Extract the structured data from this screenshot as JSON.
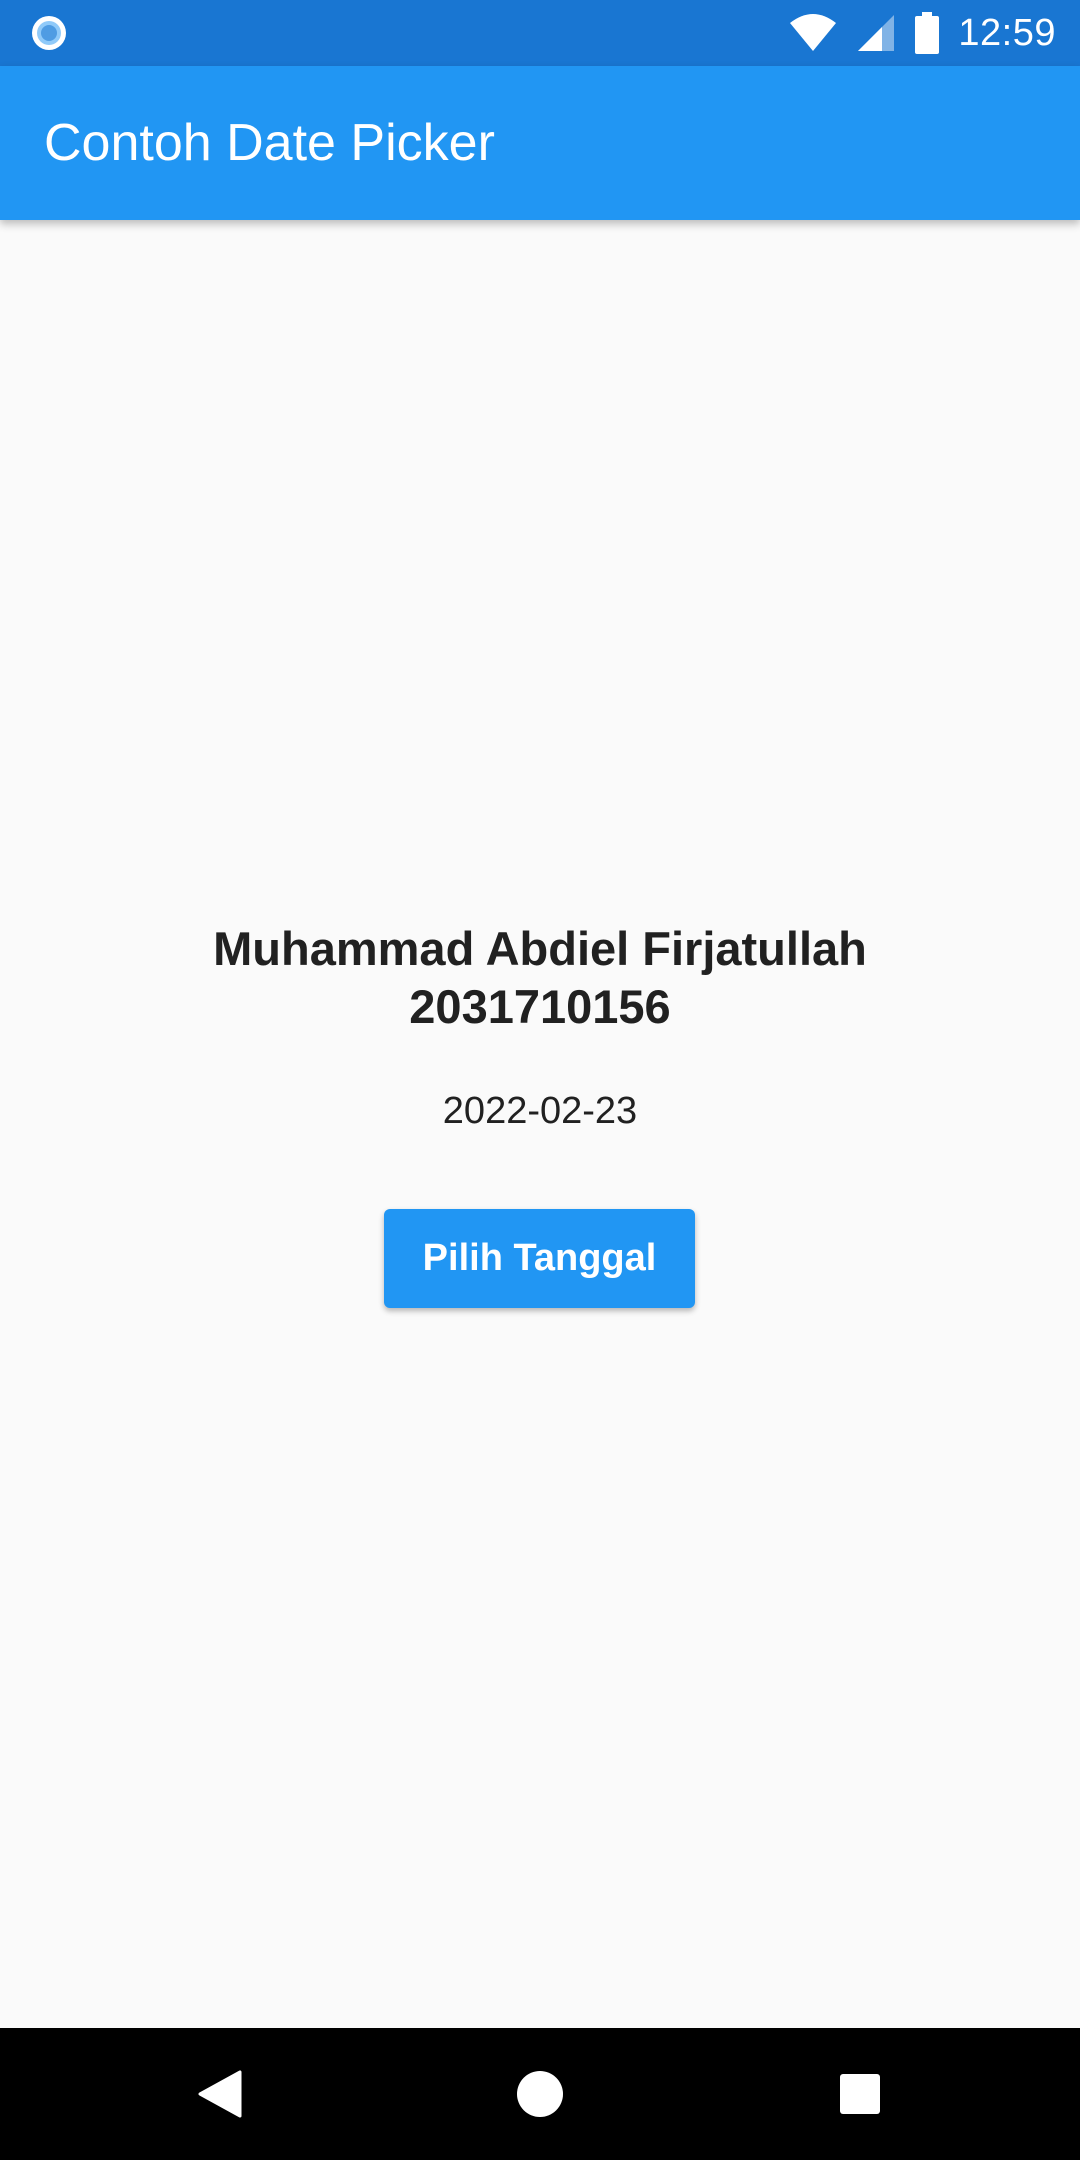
{
  "status_bar": {
    "time": "12:59",
    "color": "#1976d2",
    "icons": [
      "radio-button-icon",
      "wifi-icon",
      "signal-icon",
      "battery-icon"
    ]
  },
  "app_bar": {
    "title": "Contoh Date Picker",
    "color": "#2196f3"
  },
  "main": {
    "name_line1": "Muhammad Abdiel Firjatullah",
    "name_line2": "2031710156",
    "selected_date": "2022-02-23",
    "pick_button_label": "Pilih Tanggal"
  },
  "nav_bar": {
    "icons": [
      "back-icon",
      "home-icon",
      "recents-icon"
    ]
  }
}
